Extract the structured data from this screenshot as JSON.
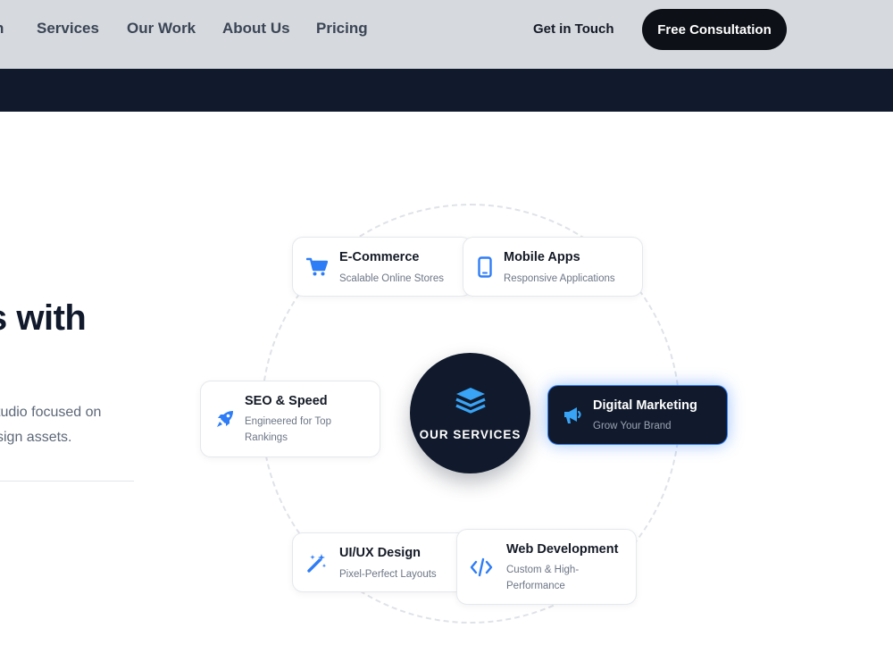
{
  "nav": {
    "cut_item": "n",
    "items": [
      "Services",
      "Our Work",
      "About Us",
      "Pricing"
    ],
    "get_in_touch": "Get in Touch",
    "cta": "Free Consultation"
  },
  "hero": {
    "title_fragment": "s with",
    "line1": "tudio focused on",
    "line2": "sign assets."
  },
  "services": {
    "center_label": "OUR SERVICES",
    "cards": [
      {
        "title": "E-Commerce",
        "subtitle": "Scalable Online Stores",
        "icon": "cart-icon"
      },
      {
        "title": "Mobile Apps",
        "subtitle": "Responsive Applications",
        "icon": "smartphone-icon"
      },
      {
        "title": "SEO & Speed",
        "subtitle": "Engineered for Top Rankings",
        "icon": "rocket-icon"
      },
      {
        "title": "Digital Marketing",
        "subtitle": "Grow Your Brand",
        "icon": "megaphone-icon"
      },
      {
        "title": "UI/UX Design",
        "subtitle": "Pixel-Perfect Layouts",
        "icon": "magic-wand-icon"
      },
      {
        "title": "Web Development",
        "subtitle": "Custom & High-Performance",
        "icon": "code-icon"
      }
    ]
  },
  "colors": {
    "accent": "#2f7df6",
    "navy": "#111a2c",
    "header_bg": "#d6d9dd",
    "cta_bg": "#0d1016"
  }
}
